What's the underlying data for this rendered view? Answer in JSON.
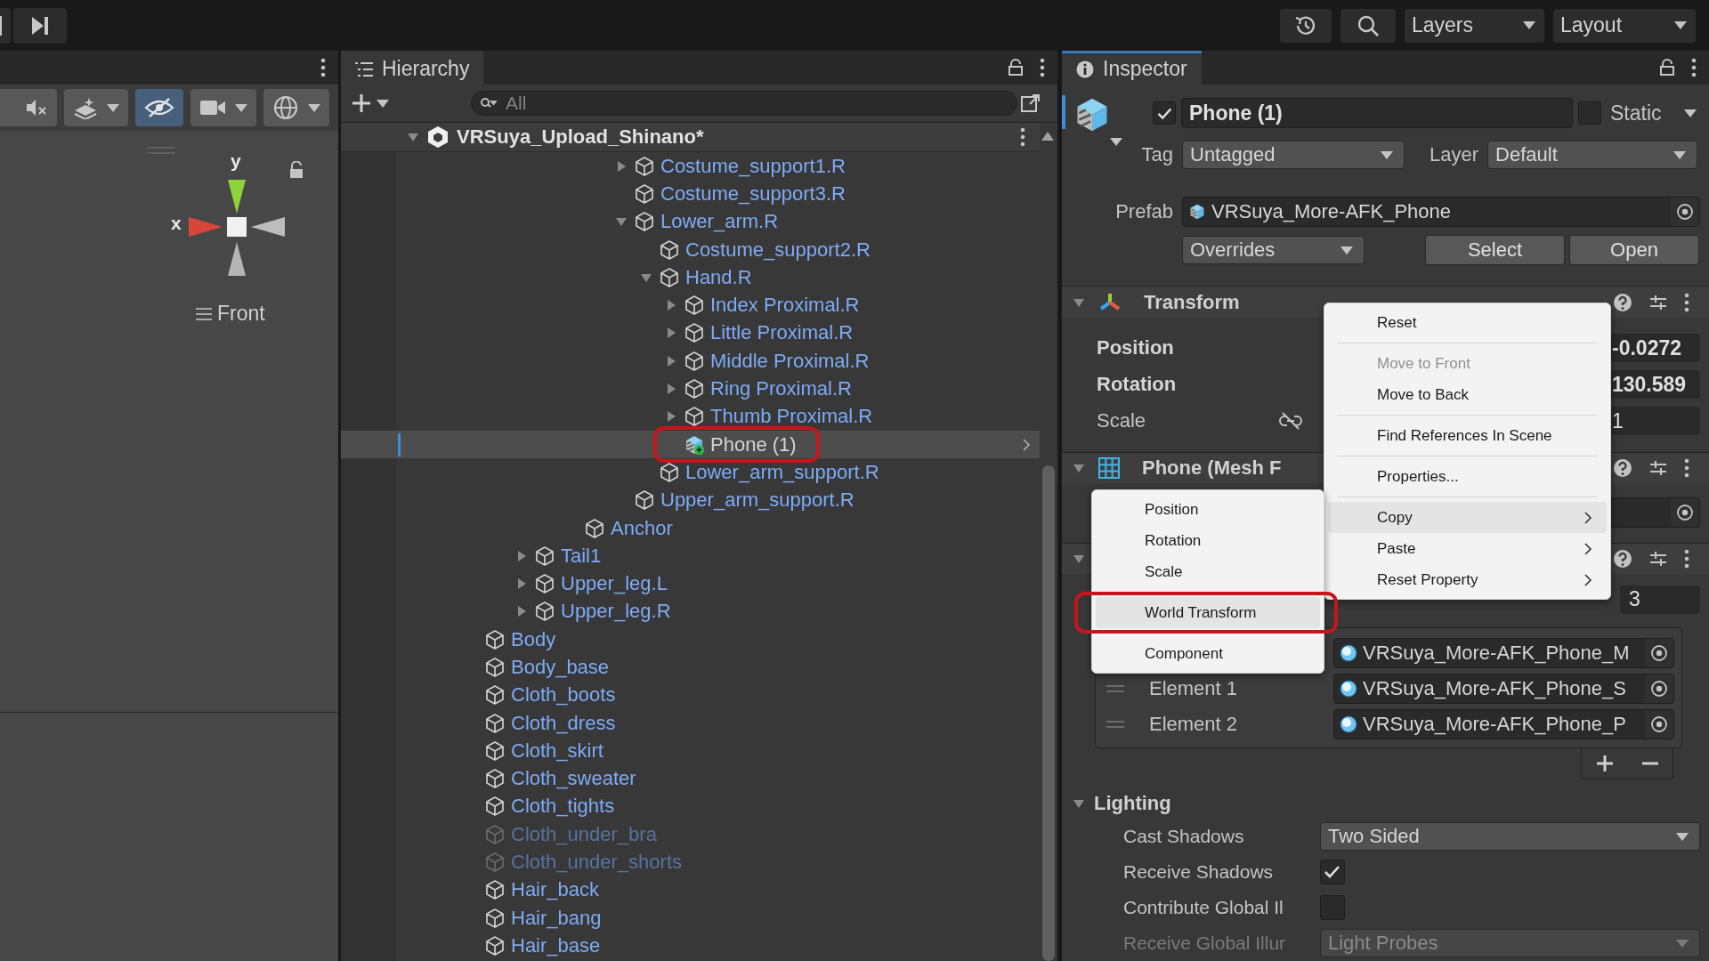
{
  "topbar": {
    "layers": "Layers",
    "layout": "Layout"
  },
  "scene_view": {
    "toolbar": [
      {
        "kind": "audio",
        "on": false
      },
      {
        "kind": "effects",
        "on": false
      },
      {
        "kind": "visibility",
        "on": true
      },
      {
        "kind": "camera",
        "on": false
      },
      {
        "kind": "gizmos",
        "on": false
      }
    ],
    "axis_y": "y",
    "axis_x": "x",
    "view": "Front"
  },
  "hierarchy": {
    "title": "Hierarchy",
    "search": {
      "placeholder": "All"
    },
    "scene": {
      "label": "VRSuya_Upload_Shinano*",
      "expanded": true,
      "children": [
        {
          "children": [
            {
              "children": [
                {
                  "children": [
                    {
                      "children": [
                        {
                          "children": [
                            {
                              "children": [
                                {
                                  "children": [
                                    {
                                      "label": "Costume_support1.R",
                                      "kind": "instance",
                                      "expanded": false,
                                      "selected": false,
                                      "disabled": false,
                                      "annotated": false
                                    },
                                    {
                                      "label": "Costume_support3.R",
                                      "kind": "instance",
                                      "selected": false,
                                      "disabled": false,
                                      "annotated": false
                                    },
                                    {
                                      "label": "Lower_arm.R",
                                      "kind": "instance",
                                      "expanded": true,
                                      "selected": false,
                                      "disabled": false,
                                      "annotated": false,
                                      "children": [
                                        {
                                          "label": "Costume_support2.R",
                                          "kind": "instance",
                                          "selected": false,
                                          "disabled": false,
                                          "annotated": false
                                        },
                                        {
                                          "label": "Hand.R",
                                          "kind": "instance",
                                          "expanded": true,
                                          "selected": false,
                                          "disabled": false,
                                          "annotated": false,
                                          "children": [
                                            {
                                              "label": "Index Proximal.R",
                                              "kind": "instance",
                                              "expanded": false,
                                              "selected": false,
                                              "disabled": false,
                                              "annotated": false
                                            },
                                            {
                                              "label": "Little Proximal.R",
                                              "kind": "instance",
                                              "expanded": false,
                                              "selected": false,
                                              "disabled": false,
                                              "annotated": false
                                            },
                                            {
                                              "label": "Middle Proximal.R",
                                              "kind": "instance",
                                              "expanded": false,
                                              "selected": false,
                                              "disabled": false,
                                              "annotated": false
                                            },
                                            {
                                              "label": "Ring Proximal.R",
                                              "kind": "instance",
                                              "expanded": false,
                                              "selected": false,
                                              "disabled": false,
                                              "annotated": false
                                            },
                                            {
                                              "label": "Thumb Proximal.R",
                                              "kind": "instance",
                                              "expanded": false,
                                              "selected": false,
                                              "disabled": false,
                                              "annotated": false
                                            },
                                            {
                                              "label": "Phone (1)",
                                              "kind": "added_prefab",
                                              "selected": true,
                                              "disabled": false,
                                              "annotated": true
                                            }
                                          ]
                                        },
                                        {
                                          "label": "Lower_arm_support.R",
                                          "kind": "instance",
                                          "selected": false,
                                          "disabled": false,
                                          "annotated": false
                                        }
                                      ]
                                    },
                                    {
                                      "label": "Upper_arm_support.R",
                                      "kind": "instance",
                                      "selected": false,
                                      "disabled": false,
                                      "annotated": false
                                    }
                                  ]
                                }
                              ]
                            },
                            {
                              "label": "Anchor",
                              "kind": "instance",
                              "selected": false,
                              "disabled": false,
                              "annotated": false
                            }
                          ]
                        }
                      ]
                    },
                    {
                      "label": "Tail1",
                      "kind": "instance",
                      "expanded": false,
                      "selected": false,
                      "disabled": false,
                      "annotated": false
                    },
                    {
                      "label": "Upper_leg.L",
                      "kind": "instance",
                      "expanded": false,
                      "selected": false,
                      "disabled": false,
                      "annotated": false
                    },
                    {
                      "label": "Upper_leg.R",
                      "kind": "instance",
                      "expanded": false,
                      "selected": false,
                      "disabled": false,
                      "annotated": false
                    }
                  ]
                }
              ]
            },
            {
              "label": "Body",
              "kind": "instance",
              "selected": false,
              "disabled": false,
              "annotated": false
            },
            {
              "label": "Body_base",
              "kind": "instance",
              "selected": false,
              "disabled": false,
              "annotated": false
            },
            {
              "label": "Cloth_boots",
              "kind": "instance",
              "selected": false,
              "disabled": false,
              "annotated": false
            },
            {
              "label": "Cloth_dress",
              "kind": "instance",
              "selected": false,
              "disabled": false,
              "annotated": false
            },
            {
              "label": "Cloth_skirt",
              "kind": "instance",
              "selected": false,
              "disabled": false,
              "annotated": false
            },
            {
              "label": "Cloth_sweater",
              "kind": "instance",
              "selected": false,
              "disabled": false,
              "annotated": false
            },
            {
              "label": "Cloth_tights",
              "kind": "instance",
              "selected": false,
              "disabled": false,
              "annotated": false
            },
            {
              "label": "Cloth_under_bra",
              "kind": "instance",
              "selected": false,
              "disabled": true,
              "annotated": false
            },
            {
              "label": "Cloth_under_shorts",
              "kind": "instance",
              "selected": false,
              "disabled": true,
              "annotated": false
            },
            {
              "label": "Hair_back",
              "kind": "instance",
              "selected": false,
              "disabled": false,
              "annotated": false
            },
            {
              "label": "Hair_bang",
              "kind": "instance",
              "selected": false,
              "disabled": false,
              "annotated": false
            },
            {
              "label": "Hair_base",
              "kind": "instance",
              "selected": false,
              "disabled": false,
              "annotated": false
            }
          ]
        }
      ]
    }
  },
  "inspector": {
    "title": "Inspector",
    "object": {
      "active": true,
      "name": "Phone (1)",
      "static": false,
      "static_label": "Static",
      "tag_label": "Tag",
      "tag": "Untagged",
      "layer_label": "Layer",
      "layer": "Default",
      "prefab_label": "Prefab",
      "prefab": "VRSuya_More-AFK_Phone",
      "overrides": "Overrides",
      "buttons": [
        "Select",
        "Open"
      ]
    },
    "transform": {
      "title": "Transform",
      "expanded": true,
      "rows": [
        {
          "label": "Position",
          "value": "-0.0272",
          "overridden": true
        },
        {
          "label": "Rotation",
          "value": "130.589",
          "overridden": true
        },
        {
          "label": "Scale",
          "value": "1",
          "overridden": false
        }
      ]
    },
    "mesh_filter": {
      "title": "Phone (Mesh F",
      "expanded": true
    },
    "mesh_renderer": {
      "expanded": true,
      "materials_size": "3",
      "elements": [
        {
          "value": "VRSuya_More-AFK_Phone_M"
        },
        {
          "label": "Element 1",
          "value": "VRSuya_More-AFK_Phone_S"
        },
        {
          "label": "Element 2",
          "value": "VRSuya_More-AFK_Phone_P"
        }
      ]
    },
    "lighting": {
      "title": "Lighting",
      "expanded": true,
      "rows": [
        {
          "kind": "dropdown",
          "label": "Cast Shadows",
          "value": "Two Sided",
          "disabled": false
        },
        {
          "kind": "checkbox",
          "label": "Receive Shadows",
          "checked": true,
          "disabled": false
        },
        {
          "kind": "checkbox",
          "label": "Contribute Global Il",
          "checked": false,
          "disabled": false
        },
        {
          "kind": "dropdown",
          "label": "Receive Global Illur",
          "value": "Light Probes",
          "disabled": true
        }
      ]
    }
  },
  "context_menu": {
    "items": [
      {
        "kind": "item",
        "label": "Reset",
        "disabled": false,
        "selected": false
      },
      {
        "kind": "separator"
      },
      {
        "kind": "item",
        "label": "Move to Front",
        "disabled": true,
        "selected": false
      },
      {
        "kind": "item",
        "label": "Move to Back",
        "disabled": false,
        "selected": false
      },
      {
        "kind": "separator"
      },
      {
        "kind": "item",
        "label": "Find References In Scene",
        "disabled": false,
        "selected": false
      },
      {
        "kind": "separator"
      },
      {
        "kind": "item",
        "label": "Properties...",
        "disabled": false,
        "selected": false
      },
      {
        "kind": "separator"
      },
      {
        "kind": "submenu",
        "label": "Copy",
        "disabled": false,
        "selected": true
      },
      {
        "kind": "submenu",
        "label": "Paste",
        "disabled": false,
        "selected": false
      },
      {
        "kind": "submenu",
        "label": "Reset Property",
        "disabled": false,
        "selected": false
      }
    ]
  },
  "submenu": {
    "items": [
      {
        "kind": "item",
        "label": "Position",
        "selected": false,
        "annotated": false
      },
      {
        "kind": "item",
        "label": "Rotation",
        "selected": false,
        "annotated": false
      },
      {
        "kind": "item",
        "label": "Scale",
        "selected": false,
        "annotated": false
      },
      {
        "kind": "separator"
      },
      {
        "kind": "item",
        "label": "World Transform",
        "selected": true,
        "annotated": true
      },
      {
        "kind": "separator"
      },
      {
        "kind": "item",
        "label": "Component",
        "selected": false,
        "annotated": false
      }
    ]
  }
}
